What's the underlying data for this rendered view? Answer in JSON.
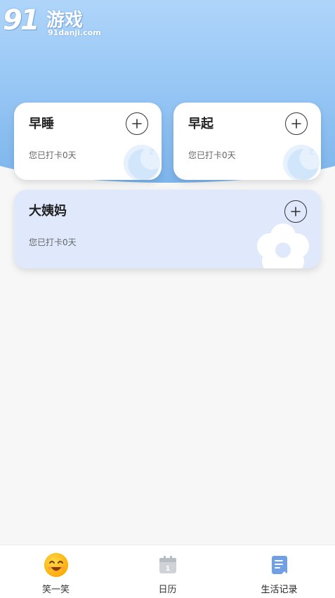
{
  "watermark": {
    "number": "91",
    "name": "游戏",
    "domain": "91danji.com"
  },
  "cards": {
    "sleep": {
      "title": "早睡",
      "status": "您已打卡0天"
    },
    "wake": {
      "title": "早起",
      "status": "您已打卡0天"
    },
    "period": {
      "title": "大姨妈",
      "status": "您已打卡0天"
    }
  },
  "tabs": [
    {
      "label": "笑一笑",
      "icon": "smiley-face-icon"
    },
    {
      "label": "日历",
      "icon": "calendar-icon"
    },
    {
      "label": "生活记录",
      "icon": "notebook-icon",
      "active": true
    }
  ],
  "colors": {
    "header_blue": "#9ccaf6",
    "card_blue": "#dfe9fb",
    "active_tab_blue": "#5a8fe0",
    "smiley_yellow": "#ffb000"
  }
}
